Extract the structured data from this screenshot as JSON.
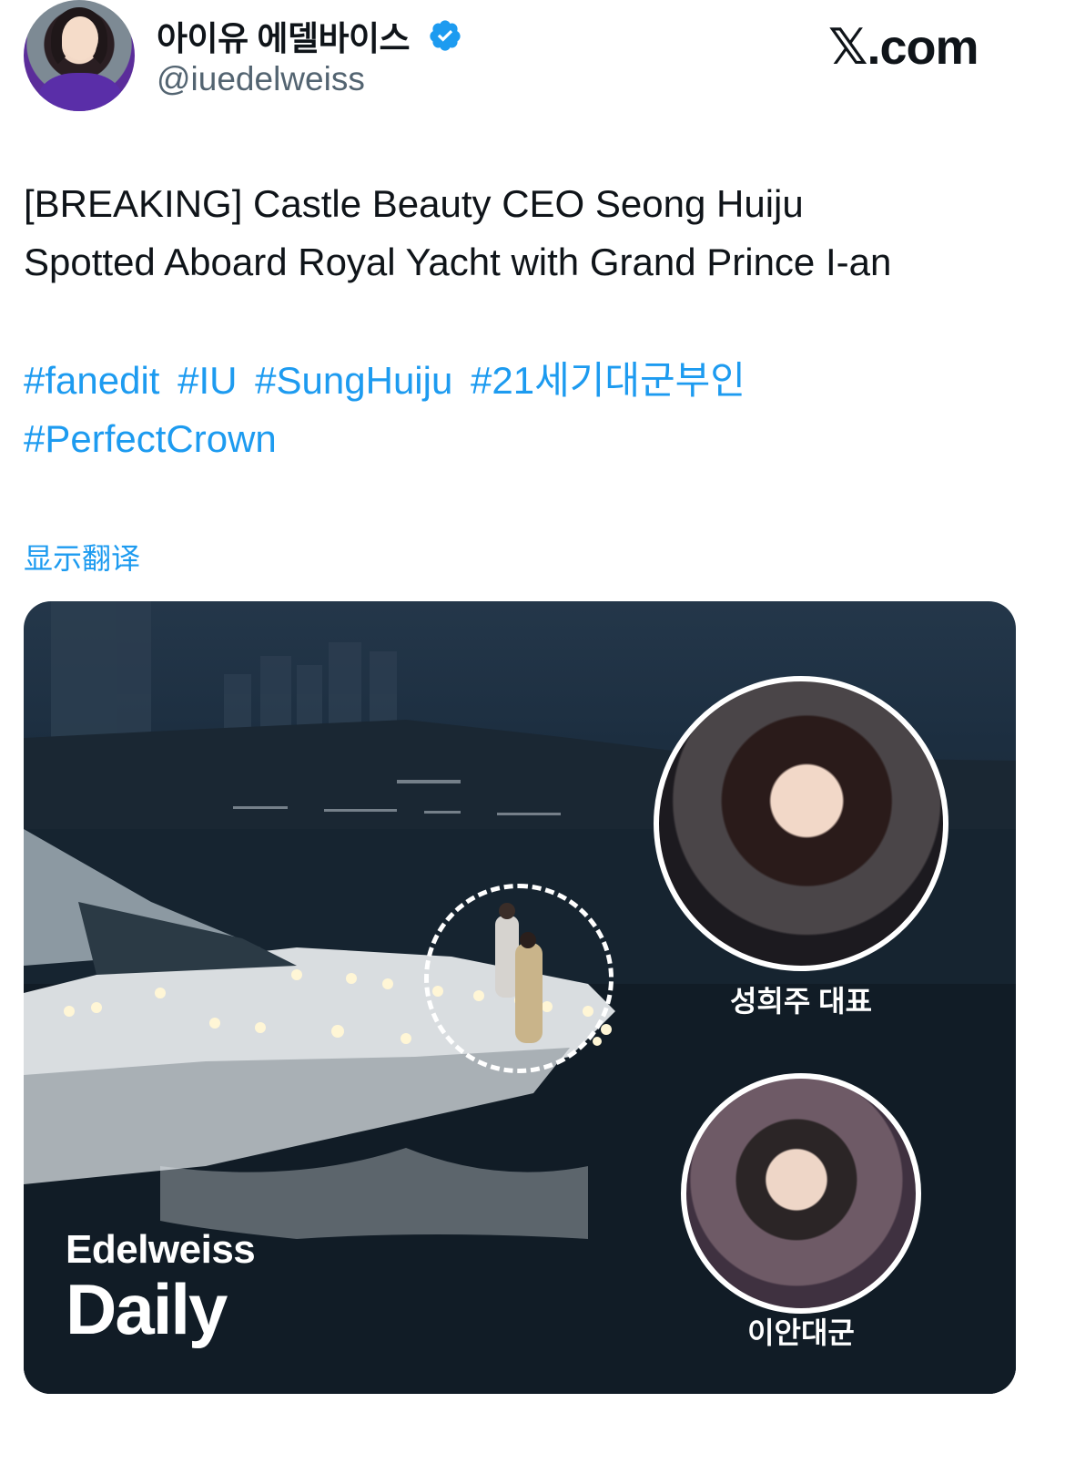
{
  "header": {
    "display_name": "아이유 에델바이스",
    "handle": "@iuedelweiss",
    "site": "𝕏.com"
  },
  "tweet": {
    "line1": "[BREAKING] Castle Beauty CEO Seong Huiju",
    "line2": "Spotted Aboard Royal Yacht with Grand Prince I-an",
    "hashtags": [
      "#fanedit",
      "#IU",
      "#SungHuiju",
      "#21세기대군부인",
      "#PerfectCrown"
    ],
    "translate": "显示翻译"
  },
  "media": {
    "caption_huiju": "성희주 대표",
    "caption_ian": "이안대군",
    "brand_top": "Edelweiss",
    "brand_bottom": "Daily"
  },
  "colors": {
    "link": "#1d9bf0",
    "verified": "#1d9bf0",
    "text": "#0f1419",
    "handle": "#536471"
  },
  "icons": {
    "verified": "verified-badge-icon"
  }
}
